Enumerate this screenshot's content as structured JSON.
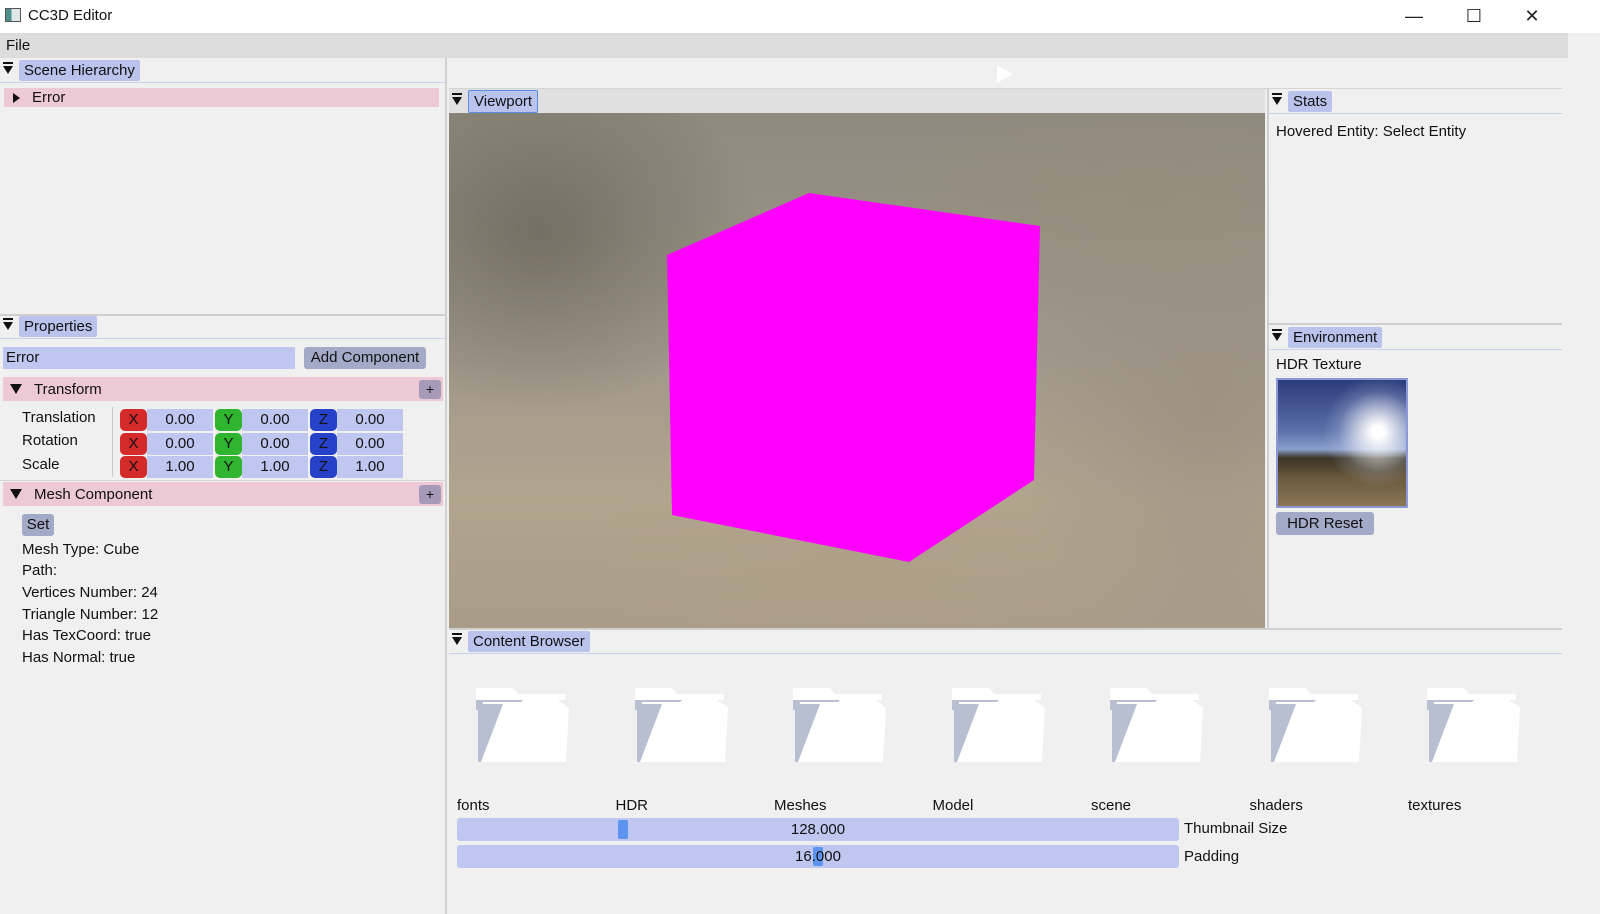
{
  "window": {
    "title": "CC3D Editor",
    "minimize": "—",
    "maximize": "☐",
    "close": "✕"
  },
  "menu": {
    "file": "File"
  },
  "scene_hierarchy": {
    "tab": "Scene Hierarchy",
    "items": [
      {
        "label": "Error"
      }
    ]
  },
  "properties": {
    "tab": "Properties",
    "entity_name": "Error",
    "add_component": "Add Component",
    "transform": {
      "header": "Transform",
      "plus": "+",
      "rows": [
        {
          "label": "Translation",
          "x": "0.00",
          "y": "0.00",
          "z": "0.00"
        },
        {
          "label": "Rotation",
          "x": "0.00",
          "y": "0.00",
          "z": "0.00"
        },
        {
          "label": "Scale",
          "x": "1.00",
          "y": "1.00",
          "z": "1.00"
        }
      ],
      "axis_x": "X",
      "axis_y": "Y",
      "axis_z": "Z"
    },
    "mesh": {
      "header": "Mesh Component",
      "plus": "+",
      "set": "Set",
      "lines": [
        "Mesh Type: Cube",
        "Path:",
        "Vertices Number: 24",
        "Triangle Number: 12",
        "Has TexCoord: true",
        "Has Normal: true"
      ]
    }
  },
  "viewport": {
    "tab": "Viewport",
    "cube_color": "#ff00ff"
  },
  "stats": {
    "tab": "Stats",
    "hovered": "Hovered Entity: Select Entity"
  },
  "environment": {
    "tab": "Environment",
    "hdr_label": "HDR Texture",
    "hdr_reset": "HDR Reset"
  },
  "content_browser": {
    "tab": "Content Browser",
    "folders": [
      "fonts",
      "HDR",
      "Meshes",
      "Model",
      "scene",
      "shaders",
      "textures"
    ],
    "thumbnail_size": {
      "label": "Thumbnail Size",
      "value": "128.000"
    },
    "padding": {
      "label": "Padding",
      "value": "16.000"
    }
  },
  "colors": {
    "accent_tab": "#b9c3ec",
    "component_header": "#ecc9d5",
    "input_bg": "#bfc7f0",
    "axis_x": "#d42a2a",
    "axis_y": "#2fb52f",
    "axis_z": "#2742c9"
  }
}
